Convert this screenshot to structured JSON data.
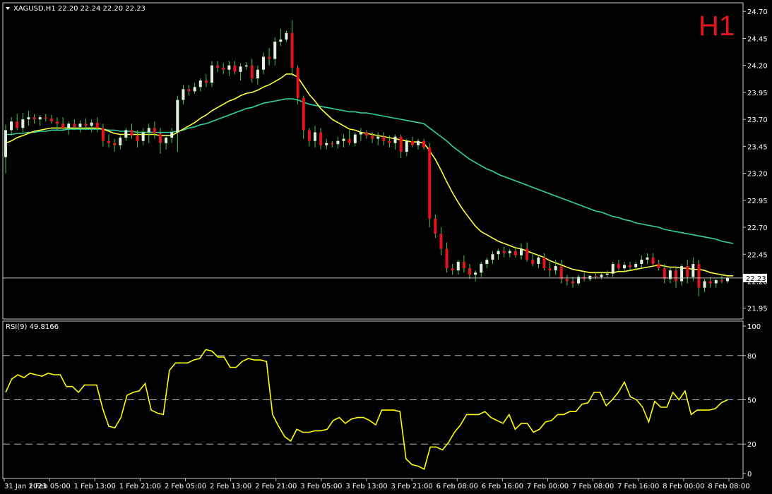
{
  "header": {
    "symbol_line": "XAGUSD,H1  22.20 22.24 22.20 22.23",
    "timeframe_badge": "H1"
  },
  "colors": {
    "background": "#000000",
    "frame": "#c8c8c8",
    "bull_candle": "#e0f2dc",
    "bear_candle": "#e4141c",
    "ma_fast": "#ffff3c",
    "ma_slow": "#2fd4a0",
    "rsi": "#ffff00",
    "price_line": "#c0c0c0",
    "timeframe_text": "#e4141c"
  },
  "chart_data": [
    {
      "type": "candlestick",
      "symbol": "XAGUSD",
      "timeframe": "H1",
      "ylim": [
        21.85,
        24.78
      ],
      "y_ticks": [
        "24.70",
        "24.45",
        "24.20",
        "23.95",
        "23.70",
        "23.45",
        "23.20",
        "22.95",
        "22.70",
        "22.45",
        "22.20",
        "21.95"
      ],
      "current_price": "22.23",
      "x_ticks": [
        "31 Jan 2023",
        "1 Feb 05:00",
        "1 Feb 13:00",
        "1 Feb 21:00",
        "2 Feb 05:00",
        "2 Feb 13:00",
        "2 Feb 21:00",
        "3 Feb 05:00",
        "3 Feb 13:00",
        "3 Feb 21:00",
        "6 Feb 08:00",
        "6 Feb 16:00",
        "7 Feb 00:00",
        "7 Feb 08:00",
        "7 Feb 16:00",
        "8 Feb 00:00",
        "8 Feb 08:00"
      ],
      "candles": [
        [
          23.35,
          23.65,
          23.2,
          23.6
        ],
        [
          23.6,
          23.72,
          23.55,
          23.68
        ],
        [
          23.68,
          23.75,
          23.6,
          23.62
        ],
        [
          23.62,
          23.76,
          23.58,
          23.7
        ],
        [
          23.7,
          23.78,
          23.64,
          23.72
        ],
        [
          23.72,
          23.75,
          23.66,
          23.7
        ],
        [
          23.7,
          23.74,
          23.64,
          23.72
        ],
        [
          23.72,
          23.75,
          23.68,
          23.71
        ],
        [
          23.71,
          23.74,
          23.66,
          23.68
        ],
        [
          23.68,
          23.72,
          23.6,
          23.66
        ],
        [
          23.66,
          23.72,
          23.6,
          23.62
        ],
        [
          23.62,
          23.68,
          23.56,
          23.66
        ],
        [
          23.66,
          23.7,
          23.6,
          23.63
        ],
        [
          23.63,
          23.69,
          23.58,
          23.66
        ],
        [
          23.66,
          23.71,
          23.6,
          23.64
        ],
        [
          23.64,
          23.7,
          23.58,
          23.67
        ],
        [
          23.67,
          23.72,
          23.58,
          23.62
        ],
        [
          23.62,
          23.66,
          23.45,
          23.5
        ],
        [
          23.5,
          23.56,
          23.44,
          23.48
        ],
        [
          23.48,
          23.52,
          23.4,
          23.46
        ],
        [
          23.46,
          23.55,
          23.42,
          23.53
        ],
        [
          23.53,
          23.62,
          23.5,
          23.6
        ],
        [
          23.6,
          23.66,
          23.52,
          23.55
        ],
        [
          23.55,
          23.6,
          23.44,
          23.5
        ],
        [
          23.5,
          23.62,
          23.46,
          23.58
        ],
        [
          23.58,
          23.66,
          23.48,
          23.62
        ],
        [
          23.62,
          23.68,
          23.52,
          23.57
        ],
        [
          23.57,
          23.62,
          23.38,
          23.48
        ],
        [
          23.48,
          23.56,
          23.42,
          23.53
        ],
        [
          23.53,
          23.62,
          23.48,
          23.58
        ],
        [
          23.58,
          23.92,
          23.4,
          23.88
        ],
        [
          23.88,
          24.02,
          23.84,
          23.98
        ],
        [
          23.98,
          24.02,
          23.92,
          23.96
        ],
        [
          23.96,
          24.04,
          23.94,
          24.0
        ],
        [
          24.0,
          24.08,
          23.96,
          24.06
        ],
        [
          24.06,
          24.12,
          24.0,
          24.04
        ],
        [
          24.04,
          24.24,
          24.0,
          24.2
        ],
        [
          24.2,
          24.24,
          24.14,
          24.18
        ],
        [
          24.18,
          24.22,
          24.12,
          24.16
        ],
        [
          24.16,
          24.24,
          24.1,
          24.2
        ],
        [
          24.2,
          24.24,
          24.12,
          24.14
        ],
        [
          24.14,
          24.22,
          24.06,
          24.19
        ],
        [
          24.19,
          24.23,
          24.16,
          24.2
        ],
        [
          24.2,
          24.26,
          24.04,
          24.08
        ],
        [
          24.08,
          24.2,
          24.02,
          24.16
        ],
        [
          24.16,
          24.32,
          24.12,
          24.28
        ],
        [
          24.28,
          24.36,
          24.2,
          24.26
        ],
        [
          24.26,
          24.46,
          24.2,
          24.42
        ],
        [
          24.42,
          24.54,
          24.38,
          24.44
        ],
        [
          24.44,
          24.52,
          24.42,
          24.5
        ],
        [
          24.5,
          24.62,
          24.1,
          24.18
        ],
        [
          24.18,
          24.2,
          23.84,
          23.9
        ],
        [
          23.9,
          23.92,
          23.52,
          23.6
        ],
        [
          23.6,
          23.62,
          23.45,
          23.5
        ],
        [
          23.5,
          23.64,
          23.44,
          23.58
        ],
        [
          23.58,
          23.62,
          23.42,
          23.46
        ],
        [
          23.46,
          23.52,
          23.42,
          23.48
        ],
        [
          23.48,
          23.5,
          23.44,
          23.47
        ],
        [
          23.47,
          23.54,
          23.43,
          23.5
        ],
        [
          23.5,
          23.56,
          23.44,
          23.52
        ],
        [
          23.52,
          23.6,
          23.46,
          23.48
        ],
        [
          23.48,
          23.58,
          23.45,
          23.56
        ],
        [
          23.56,
          23.62,
          23.5,
          23.58
        ],
        [
          23.58,
          23.6,
          23.52,
          23.55
        ],
        [
          23.55,
          23.58,
          23.48,
          23.52
        ],
        [
          23.52,
          23.58,
          23.46,
          23.54
        ],
        [
          23.54,
          23.58,
          23.46,
          23.5
        ],
        [
          23.5,
          23.55,
          23.44,
          23.48
        ],
        [
          23.48,
          23.56,
          23.42,
          23.54
        ],
        [
          23.54,
          23.56,
          23.34,
          23.4
        ],
        [
          23.4,
          23.52,
          23.36,
          23.5
        ],
        [
          23.5,
          23.54,
          23.44,
          23.46
        ],
        [
          23.46,
          23.52,
          23.42,
          23.5
        ],
        [
          23.5,
          23.52,
          23.42,
          23.44
        ],
        [
          23.44,
          23.48,
          22.7,
          22.78
        ],
        [
          22.78,
          22.82,
          22.6,
          22.64
        ],
        [
          22.64,
          22.7,
          22.44,
          22.5
        ],
        [
          22.5,
          22.56,
          22.28,
          22.32
        ],
        [
          22.32,
          22.36,
          22.26,
          22.3
        ],
        [
          22.3,
          22.4,
          22.26,
          22.38
        ],
        [
          22.38,
          22.44,
          22.28,
          22.32
        ],
        [
          22.32,
          22.36,
          22.22,
          22.26
        ],
        [
          22.26,
          22.3,
          22.2,
          22.28
        ],
        [
          22.28,
          22.38,
          22.24,
          22.36
        ],
        [
          22.36,
          22.42,
          22.32,
          22.4
        ],
        [
          22.4,
          22.48,
          22.36,
          22.45
        ],
        [
          22.45,
          22.5,
          22.4,
          22.48
        ],
        [
          22.48,
          22.52,
          22.42,
          22.46
        ],
        [
          22.46,
          22.5,
          22.42,
          22.48
        ],
        [
          22.48,
          22.52,
          22.42,
          22.44
        ],
        [
          22.44,
          22.55,
          22.4,
          22.5
        ],
        [
          22.5,
          22.56,
          22.38,
          22.4
        ],
        [
          22.4,
          22.46,
          22.34,
          22.36
        ],
        [
          22.36,
          22.44,
          22.32,
          22.42
        ],
        [
          22.42,
          22.46,
          22.3,
          22.32
        ],
        [
          22.32,
          22.38,
          22.24,
          22.3
        ],
        [
          22.3,
          22.4,
          22.26,
          22.34
        ],
        [
          22.34,
          22.4,
          22.18,
          22.22
        ],
        [
          22.22,
          22.26,
          22.16,
          22.2
        ],
        [
          22.2,
          22.24,
          22.14,
          22.18
        ],
        [
          22.18,
          22.26,
          22.16,
          22.24
        ],
        [
          22.24,
          22.28,
          22.2,
          22.22
        ],
        [
          22.22,
          22.26,
          22.2,
          22.25
        ],
        [
          22.25,
          22.28,
          22.22,
          22.24
        ],
        [
          22.24,
          22.28,
          22.22,
          22.26
        ],
        [
          22.26,
          22.3,
          22.24,
          22.27
        ],
        [
          22.27,
          22.38,
          22.24,
          22.36
        ],
        [
          22.36,
          22.4,
          22.3,
          22.32
        ],
        [
          22.32,
          22.38,
          22.28,
          22.35
        ],
        [
          22.35,
          22.38,
          22.3,
          22.33
        ],
        [
          22.33,
          22.38,
          22.3,
          22.36
        ],
        [
          22.36,
          22.44,
          22.32,
          22.4
        ],
        [
          22.4,
          22.46,
          22.36,
          22.42
        ],
        [
          22.42,
          22.46,
          22.34,
          22.36
        ],
        [
          22.36,
          22.4,
          22.3,
          22.32
        ],
        [
          22.32,
          22.36,
          22.18,
          22.22
        ],
        [
          22.22,
          22.34,
          22.18,
          22.3
        ],
        [
          22.3,
          22.34,
          22.14,
          22.2
        ],
        [
          22.2,
          22.36,
          22.16,
          22.34
        ],
        [
          22.34,
          22.4,
          22.18,
          22.24
        ],
        [
          22.24,
          22.42,
          22.2,
          22.36
        ],
        [
          22.36,
          22.4,
          22.06,
          22.14
        ],
        [
          22.14,
          22.22,
          22.1,
          22.2
        ],
        [
          22.2,
          22.24,
          22.14,
          22.18
        ],
        [
          22.18,
          22.22,
          22.14,
          22.21
        ],
        [
          22.21,
          22.26,
          22.18,
          22.2
        ],
        [
          22.2,
          22.24,
          22.18,
          22.23
        ]
      ],
      "ma_fast": [
        23.48,
        23.5,
        23.53,
        23.55,
        23.57,
        23.59,
        23.6,
        23.61,
        23.62,
        23.62,
        23.62,
        23.62,
        23.62,
        23.62,
        23.62,
        23.62,
        23.62,
        23.61,
        23.59,
        23.57,
        23.56,
        23.56,
        23.56,
        23.56,
        23.56,
        23.56,
        23.56,
        23.55,
        23.55,
        23.55,
        23.58,
        23.61,
        23.64,
        23.67,
        23.71,
        23.74,
        23.78,
        23.81,
        23.84,
        23.87,
        23.89,
        23.92,
        23.94,
        23.95,
        23.97,
        24.0,
        24.02,
        24.05,
        24.08,
        24.12,
        24.12,
        24.09,
        24.01,
        23.93,
        23.87,
        23.8,
        23.75,
        23.7,
        23.67,
        23.64,
        23.61,
        23.6,
        23.58,
        23.57,
        23.56,
        23.55,
        23.54,
        23.53,
        23.52,
        23.51,
        23.5,
        23.49,
        23.49,
        23.48,
        23.41,
        23.33,
        23.23,
        23.12,
        23.02,
        22.93,
        22.85,
        22.78,
        22.71,
        22.66,
        22.63,
        22.6,
        22.57,
        22.55,
        22.53,
        22.51,
        22.5,
        22.48,
        22.46,
        22.44,
        22.42,
        22.39,
        22.37,
        22.35,
        22.33,
        22.31,
        22.3,
        22.29,
        22.28,
        22.28,
        22.28,
        22.28,
        22.28,
        22.29,
        22.29,
        22.3,
        22.31,
        22.32,
        22.33,
        22.34,
        22.35,
        22.34,
        22.33,
        22.33,
        22.32,
        22.32,
        22.31,
        22.31,
        22.3,
        22.28,
        22.27,
        22.26,
        22.25,
        22.25
      ],
      "ma_slow": [
        23.56,
        23.56,
        23.57,
        23.57,
        23.58,
        23.58,
        23.59,
        23.59,
        23.6,
        23.6,
        23.6,
        23.61,
        23.61,
        23.61,
        23.61,
        23.61,
        23.61,
        23.61,
        23.6,
        23.6,
        23.59,
        23.59,
        23.59,
        23.58,
        23.58,
        23.58,
        23.58,
        23.58,
        23.58,
        23.58,
        23.59,
        23.6,
        23.62,
        23.63,
        23.65,
        23.66,
        23.68,
        23.7,
        23.72,
        23.74,
        23.76,
        23.78,
        23.8,
        23.81,
        23.83,
        23.85,
        23.86,
        23.87,
        23.88,
        23.89,
        23.89,
        23.88,
        23.86,
        23.84,
        23.83,
        23.82,
        23.81,
        23.8,
        23.79,
        23.78,
        23.77,
        23.77,
        23.76,
        23.76,
        23.75,
        23.74,
        23.73,
        23.72,
        23.71,
        23.7,
        23.69,
        23.68,
        23.67,
        23.66,
        23.62,
        23.58,
        23.54,
        23.5,
        23.45,
        23.41,
        23.37,
        23.33,
        23.3,
        23.27,
        23.24,
        23.22,
        23.19,
        23.17,
        23.15,
        23.13,
        23.11,
        23.09,
        23.07,
        23.05,
        23.03,
        23.01,
        22.99,
        22.97,
        22.95,
        22.93,
        22.91,
        22.89,
        22.87,
        22.85,
        22.84,
        22.82,
        22.8,
        22.79,
        22.77,
        22.76,
        22.74,
        22.73,
        22.72,
        22.71,
        22.7,
        22.68,
        22.67,
        22.66,
        22.65,
        22.64,
        22.63,
        22.62,
        22.61,
        22.6,
        22.59,
        22.57,
        22.56,
        22.55
      ]
    },
    {
      "type": "line",
      "title": "RSI(9) 49.8166",
      "ylim": [
        0,
        100
      ],
      "y_ticks": [
        "100",
        "80",
        "50",
        "20",
        "0"
      ],
      "levels": [
        80,
        50,
        20
      ],
      "series": [
        {
          "name": "RSI(9)",
          "values": [
            55,
            64,
            67,
            65,
            68,
            67,
            66,
            68,
            67,
            67,
            59,
            59,
            55,
            60,
            60,
            60,
            44,
            32,
            31,
            38,
            53,
            55,
            56,
            61,
            43,
            41,
            40,
            70,
            75,
            75,
            75,
            77,
            78,
            84,
            83,
            79,
            79,
            72,
            72,
            76,
            78,
            77,
            77,
            76,
            40,
            32,
            25,
            22,
            30,
            28,
            28,
            29,
            29,
            30,
            36,
            38,
            34,
            37,
            38,
            38,
            36,
            33,
            43,
            43,
            43,
            42,
            10,
            6,
            5,
            3,
            18,
            18,
            16,
            21,
            28,
            33,
            40,
            40,
            40,
            42,
            38,
            36,
            34,
            40,
            30,
            34,
            34,
            28,
            30,
            35,
            36,
            40,
            40,
            42,
            42,
            47,
            48,
            55,
            55,
            46,
            50,
            55,
            62,
            52,
            50,
            45,
            35,
            49,
            45,
            45,
            55,
            50,
            56,
            40,
            43,
            43,
            43,
            44,
            48,
            50
          ]
        }
      ]
    }
  ]
}
